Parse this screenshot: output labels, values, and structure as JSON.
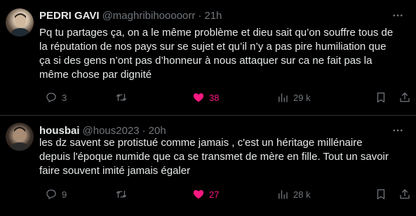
{
  "colors": {
    "background": "#000000",
    "text": "#e7e9ea",
    "muted": "#71767b",
    "like": "#f91880",
    "divider": "#2f3336"
  },
  "tweets": [
    {
      "name": "PEDRI GAVI",
      "handle": "@maghribihooooorr",
      "dot": "·",
      "time": "21h",
      "text_lines": [
        "Pq tu partages ça, on a le même problème et dieu sait qu’on souffre tous de",
        "la réputation de nos pays sur se sujet et qu’il n’y a pas pire humiliation que",
        "ça si des gens n’ont pas d’honneur à nous attaquer sur ca ne fait pas la",
        "même chose par dignité"
      ],
      "replies": "3",
      "reposts": "",
      "likes": "38",
      "views": "29 k",
      "liked": true,
      "icons": [
        "more-icon",
        "reply-icon",
        "repost-icon",
        "heart-filled-icon",
        "views-icon",
        "bookmark-icon",
        "share-icon"
      ]
    },
    {
      "name": "housbai",
      "handle": "@hous2023",
      "dot": "·",
      "time": "20h",
      "text_lines": [
        "les dz savent se protistué comme jamais , c'est un héritage millénaire",
        "depuis l'époque numide que ca se transmet de mère en fille. Tout un savoir",
        "faire souvent imité jamais égaler"
      ],
      "replies": "9",
      "reposts": "",
      "likes": "27",
      "views": "28 k",
      "liked": true,
      "icons": [
        "more-icon",
        "reply-icon",
        "repost-icon",
        "heart-filled-icon",
        "views-icon",
        "bookmark-icon",
        "share-icon"
      ]
    }
  ]
}
